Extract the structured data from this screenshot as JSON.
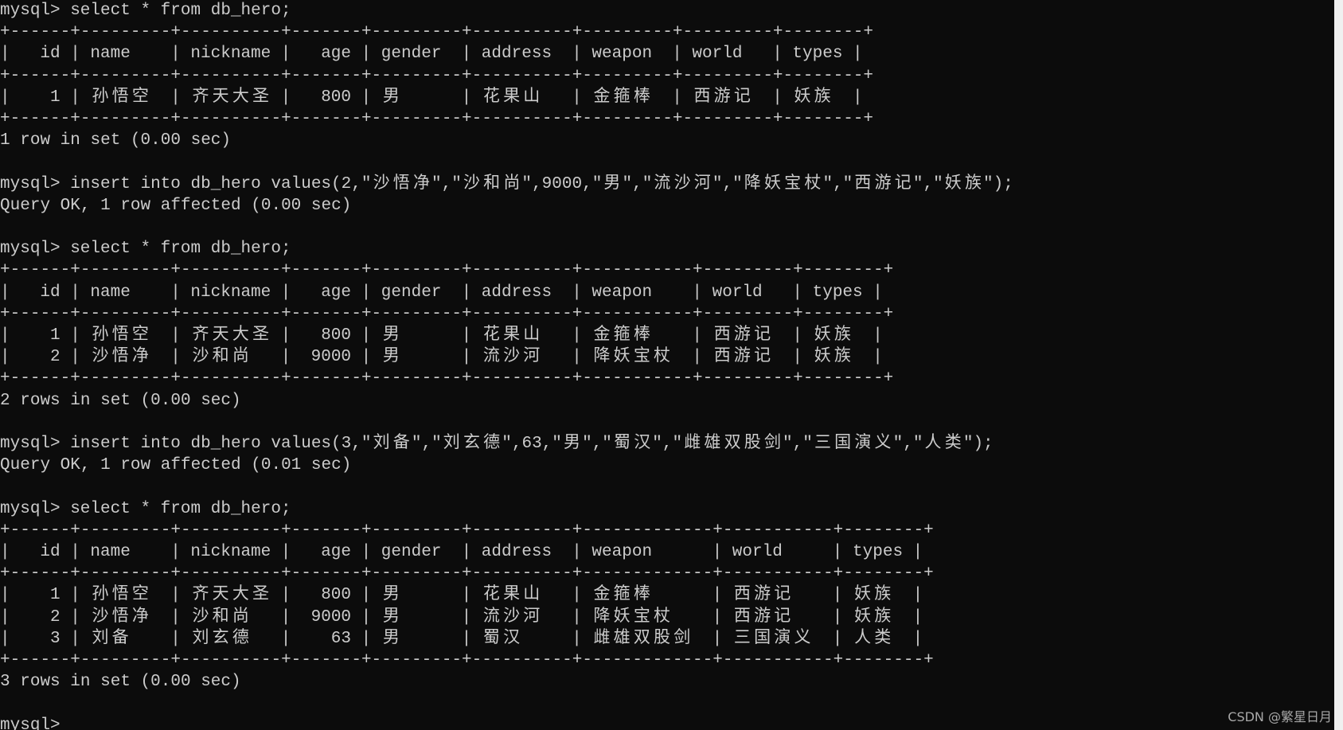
{
  "terminal": {
    "prompt": "mysql>",
    "colors": {
      "background": "#0c0c0c",
      "foreground": "#cccccc"
    },
    "blocks": [
      {
        "type": "command",
        "text": "select * from db_hero;"
      },
      {
        "type": "table",
        "columns": [
          "id",
          "name",
          "nickname",
          "age",
          "gender",
          "address",
          "weapon",
          "world",
          "types"
        ],
        "widths": [
          6,
          9,
          10,
          7,
          9,
          10,
          9,
          9,
          8
        ],
        "align": [
          "right",
          "left",
          "left",
          "right",
          "left",
          "left",
          "left",
          "left",
          "left"
        ],
        "rows": [
          [
            "1",
            "孙悟空",
            "齐天大圣",
            "800",
            "男",
            "花果山",
            "金箍棒",
            "西游记",
            "妖族"
          ]
        ]
      },
      {
        "type": "output",
        "text": "1 row in set (0.00 sec)"
      },
      {
        "type": "blank"
      },
      {
        "type": "command",
        "text": "insert into db_hero values(2,\"沙悟净\",\"沙和尚\",9000,\"男\",\"流沙河\",\"降妖宝杖\",\"西游记\",\"妖族\");"
      },
      {
        "type": "output",
        "text": "Query OK, 1 row affected (0.00 sec)"
      },
      {
        "type": "blank"
      },
      {
        "type": "command",
        "text": "select * from db_hero;"
      },
      {
        "type": "table",
        "columns": [
          "id",
          "name",
          "nickname",
          "age",
          "gender",
          "address",
          "weapon",
          "world",
          "types"
        ],
        "widths": [
          6,
          9,
          10,
          7,
          9,
          10,
          11,
          9,
          8
        ],
        "align": [
          "right",
          "left",
          "left",
          "right",
          "left",
          "left",
          "left",
          "left",
          "left"
        ],
        "rows": [
          [
            "1",
            "孙悟空",
            "齐天大圣",
            "800",
            "男",
            "花果山",
            "金箍棒",
            "西游记",
            "妖族"
          ],
          [
            "2",
            "沙悟净",
            "沙和尚",
            "9000",
            "男",
            "流沙河",
            "降妖宝杖",
            "西游记",
            "妖族"
          ]
        ]
      },
      {
        "type": "output",
        "text": "2 rows in set (0.00 sec)"
      },
      {
        "type": "blank"
      },
      {
        "type": "command",
        "text": "insert into db_hero values(3,\"刘备\",\"刘玄德\",63,\"男\",\"蜀汉\",\"雌雄双股剑\",\"三国演义\",\"人类\");"
      },
      {
        "type": "output",
        "text": "Query OK, 1 row affected (0.01 sec)"
      },
      {
        "type": "blank"
      },
      {
        "type": "command",
        "text": "select * from db_hero;"
      },
      {
        "type": "table",
        "columns": [
          "id",
          "name",
          "nickname",
          "age",
          "gender",
          "address",
          "weapon",
          "world",
          "types"
        ],
        "widths": [
          6,
          9,
          10,
          7,
          9,
          10,
          13,
          11,
          8
        ],
        "align": [
          "right",
          "left",
          "left",
          "right",
          "left",
          "left",
          "left",
          "left",
          "left"
        ],
        "rows": [
          [
            "1",
            "孙悟空",
            "齐天大圣",
            "800",
            "男",
            "花果山",
            "金箍棒",
            "西游记",
            "妖族"
          ],
          [
            "2",
            "沙悟净",
            "沙和尚",
            "9000",
            "男",
            "流沙河",
            "降妖宝杖",
            "西游记",
            "妖族"
          ],
          [
            "3",
            "刘备",
            "刘玄德",
            "63",
            "男",
            "蜀汉",
            "雌雄双股剑",
            "三国演义",
            "人类"
          ]
        ]
      },
      {
        "type": "output",
        "text": "3 rows in set (0.00 sec)"
      },
      {
        "type": "blank"
      },
      {
        "type": "prompt",
        "text": ""
      }
    ]
  },
  "watermark": "CSDN @繁星日月"
}
